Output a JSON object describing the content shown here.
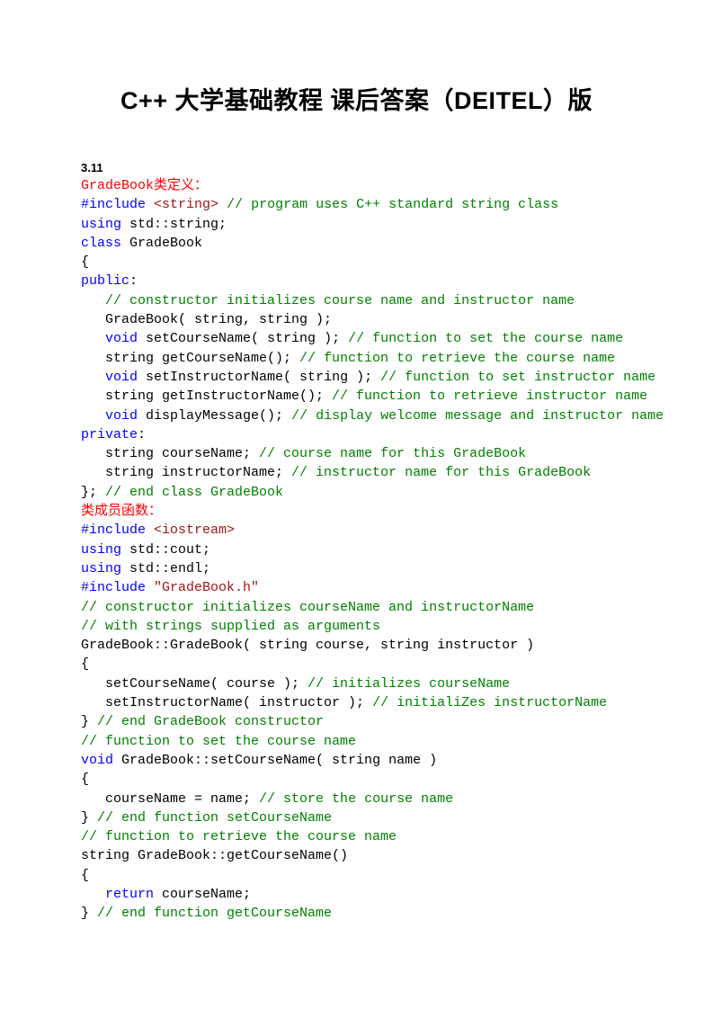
{
  "title": "C++ 大学基础教程 课后答案（DEITEL）版",
  "section": "3.11",
  "lines": [
    [
      {
        "t": "GradeBook类定义：",
        "c": "red"
      }
    ],
    [
      {
        "t": "#include",
        "c": "kw"
      },
      {
        "t": " ",
        "c": "blk"
      },
      {
        "t": "<string>",
        "c": "inc"
      },
      {
        "t": " ",
        "c": "blk"
      },
      {
        "t": "// program uses C++ standard string class",
        "c": "cm"
      }
    ],
    [
      {
        "t": "using",
        "c": "kw"
      },
      {
        "t": " std::string;",
        "c": "blk"
      }
    ],
    [
      {
        "t": "class",
        "c": "kw"
      },
      {
        "t": " GradeBook",
        "c": "blk"
      }
    ],
    [
      {
        "t": "{",
        "c": "blk"
      }
    ],
    [
      {
        "t": "public",
        "c": "kw"
      },
      {
        "t": ":",
        "c": "blk"
      }
    ],
    [
      {
        "t": "   ",
        "c": "blk"
      },
      {
        "t": "// constructor initializes course name and instructor name",
        "c": "cm"
      }
    ],
    [
      {
        "t": "   GradeBook( string, string );",
        "c": "blk"
      }
    ],
    [
      {
        "t": "   ",
        "c": "blk"
      },
      {
        "t": "void",
        "c": "kw"
      },
      {
        "t": " setCourseName( string ); ",
        "c": "blk"
      },
      {
        "t": "// function to set the course name",
        "c": "cm"
      }
    ],
    [
      {
        "t": "   string getCourseName(); ",
        "c": "blk"
      },
      {
        "t": "// function to retrieve the course name",
        "c": "cm"
      }
    ],
    [
      {
        "t": "   ",
        "c": "blk"
      },
      {
        "t": "void",
        "c": "kw"
      },
      {
        "t": " setInstructorName( string ); ",
        "c": "blk"
      },
      {
        "t": "// function to set instructor name",
        "c": "cm"
      }
    ],
    [
      {
        "t": "   string getInstructorName(); ",
        "c": "blk"
      },
      {
        "t": "// function to retrieve instructor name",
        "c": "cm"
      }
    ],
    [
      {
        "t": "   ",
        "c": "blk"
      },
      {
        "t": "void",
        "c": "kw"
      },
      {
        "t": " displayMessage(); ",
        "c": "blk"
      },
      {
        "t": "// display welcome message and instructor name",
        "c": "cm"
      }
    ],
    [
      {
        "t": "private",
        "c": "kw"
      },
      {
        "t": ":",
        "c": "blk"
      }
    ],
    [
      {
        "t": "   string courseName; ",
        "c": "blk"
      },
      {
        "t": "// course name for this GradeBook",
        "c": "cm"
      }
    ],
    [
      {
        "t": "   string instructorName; ",
        "c": "blk"
      },
      {
        "t": "// instructor name for this GradeBook",
        "c": "cm"
      }
    ],
    [
      {
        "t": "}; ",
        "c": "blk"
      },
      {
        "t": "// end class GradeBook",
        "c": "cm"
      }
    ],
    [
      {
        "t": "类成员函数：",
        "c": "red"
      }
    ],
    [
      {
        "t": "#include",
        "c": "kw"
      },
      {
        "t": " ",
        "c": "blk"
      },
      {
        "t": "<iostream>",
        "c": "inc"
      }
    ],
    [
      {
        "t": "using",
        "c": "kw"
      },
      {
        "t": " std::cout;",
        "c": "blk"
      }
    ],
    [
      {
        "t": "using",
        "c": "kw"
      },
      {
        "t": " std::endl;",
        "c": "blk"
      }
    ],
    [
      {
        "t": "#include",
        "c": "kw"
      },
      {
        "t": " ",
        "c": "blk"
      },
      {
        "t": "\"GradeBook.h\"",
        "c": "inc"
      }
    ],
    [
      {
        "t": "// constructor initializes courseName and instructorName",
        "c": "cm"
      }
    ],
    [
      {
        "t": "// with strings supplied as arguments",
        "c": "cm"
      }
    ],
    [
      {
        "t": "GradeBook::GradeBook( string course, string instructor )",
        "c": "blk"
      }
    ],
    [
      {
        "t": "{",
        "c": "blk"
      }
    ],
    [
      {
        "t": "   setCourseName( course ); ",
        "c": "blk"
      },
      {
        "t": "// initializes courseName",
        "c": "cm"
      }
    ],
    [
      {
        "t": "   setInstructorName( instructor ); ",
        "c": "blk"
      },
      {
        "t": "// initialiZes instructorName",
        "c": "cm"
      }
    ],
    [
      {
        "t": "} ",
        "c": "blk"
      },
      {
        "t": "// end GradeBook constructor",
        "c": "cm"
      }
    ],
    [
      {
        "t": "// function to set the course name",
        "c": "cm"
      }
    ],
    [
      {
        "t": "void",
        "c": "kw"
      },
      {
        "t": " GradeBook::setCourseName( string name )",
        "c": "blk"
      }
    ],
    [
      {
        "t": "{",
        "c": "blk"
      }
    ],
    [
      {
        "t": "   courseName = name; ",
        "c": "blk"
      },
      {
        "t": "// store the course name",
        "c": "cm"
      }
    ],
    [
      {
        "t": "} ",
        "c": "blk"
      },
      {
        "t": "// end function setCourseName",
        "c": "cm"
      }
    ],
    [
      {
        "t": "// function to retrieve the course name",
        "c": "cm"
      }
    ],
    [
      {
        "t": "string GradeBook::getCourseName()",
        "c": "blk"
      }
    ],
    [
      {
        "t": "{",
        "c": "blk"
      }
    ],
    [
      {
        "t": "   ",
        "c": "blk"
      },
      {
        "t": "return",
        "c": "kw"
      },
      {
        "t": " courseName;",
        "c": "blk"
      }
    ],
    [
      {
        "t": "} ",
        "c": "blk"
      },
      {
        "t": "// end function getCourseName",
        "c": "cm"
      }
    ]
  ]
}
